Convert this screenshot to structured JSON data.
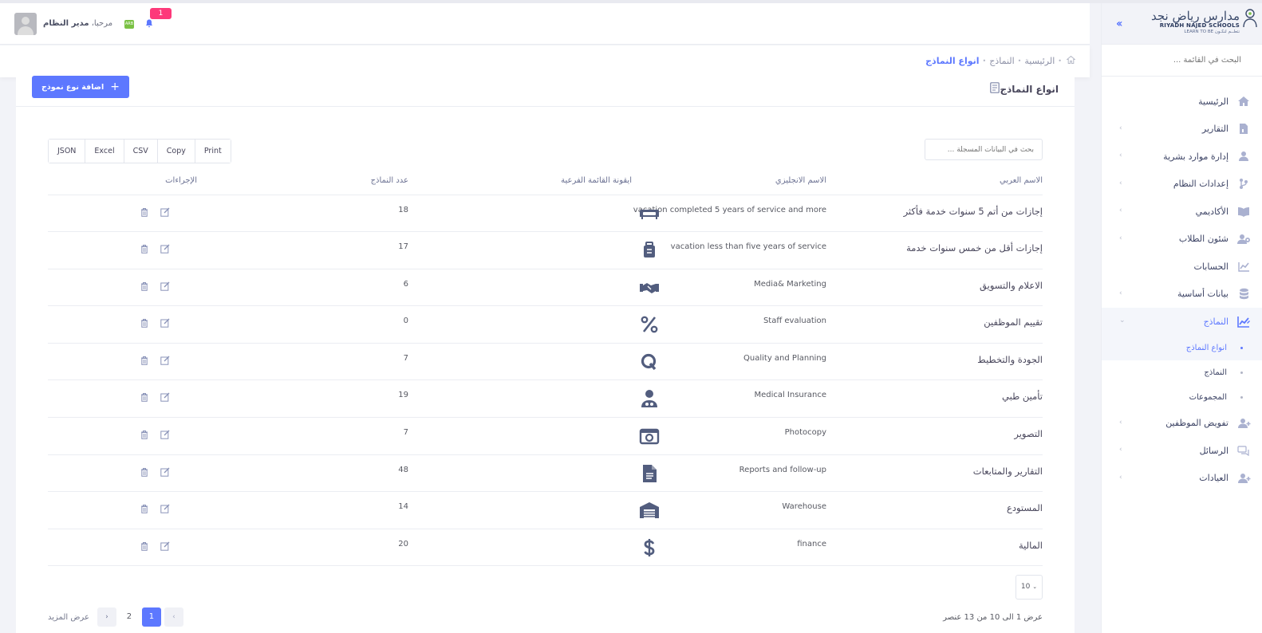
{
  "brand": {
    "name_ar": "مدارس رياض نجد",
    "name_en": "RIYADH NAJED SCHOOLS",
    "tagline": "LEARN TO BE  نتعلــم لنكـون"
  },
  "sidebar": {
    "search_placeholder": "البحث في القائمة ...",
    "items": [
      {
        "label": "الرئيسية",
        "icon": "home-icon",
        "chevron": false
      },
      {
        "label": "التقارير",
        "icon": "report-file-icon",
        "chevron": true
      },
      {
        "label": "إدارة موارد بشرية",
        "icon": "user-icon",
        "chevron": true
      },
      {
        "label": "إعدادات النظام",
        "icon": "git-branch-icon",
        "chevron": true
      },
      {
        "label": "الأكاديمي",
        "icon": "book-icon",
        "chevron": true
      },
      {
        "label": "شئون الطلاب",
        "icon": "users-gear-icon",
        "chevron": true
      },
      {
        "label": "الحسابات",
        "icon": "line-chart-icon",
        "chevron": false
      },
      {
        "label": "بيانات أساسية",
        "icon": "database-icon",
        "chevron": true
      },
      {
        "label": "النماذج",
        "icon": "chart-edit-icon",
        "chevron": true
      }
    ],
    "subitems": [
      {
        "label": "انواع النماذج"
      },
      {
        "label": "النماذج"
      },
      {
        "label": "المجموعات"
      }
    ],
    "items_after": [
      {
        "label": "تفويض الموظفين",
        "icon": "user-add-icon",
        "chevron": true
      },
      {
        "label": "الرسائل",
        "icon": "chat-icon",
        "chevron": true
      },
      {
        "label": "العيادات",
        "icon": "user-add-icon",
        "chevron": true
      }
    ]
  },
  "header": {
    "greeting": "مرحبا،",
    "user": "مدير النظام",
    "notification_count": "1",
    "lang_badge": "ARB"
  },
  "breadcrumb": [
    "الرئيسية",
    "النماذج",
    "انواع النماذج"
  ],
  "portlet": {
    "title": "انواع النماذج",
    "add_button": "اضافة نوع نموذج"
  },
  "export_buttons": [
    "JSON",
    "Excel",
    "CSV",
    "Copy",
    "Print"
  ],
  "table_search_placeholder": "بحث في البيانات المسجلة ...",
  "table": {
    "headers": [
      "الاسم العربي",
      "الاسم الانجليزي",
      "ايقونة القائمة الفرعية",
      "عدد النماذج",
      "الإجراءات"
    ],
    "rows": [
      {
        "ar": "إجازات من أتم 5 سنوات خدمة فأكثر",
        "en": "vacation completed 5 years of service and more",
        "icon": "couch-icon",
        "count": "18"
      },
      {
        "ar": "إجازات أقل من خمس سنوات خدمة",
        "en": "vacation less than five years of service",
        "icon": "suitcase-icon",
        "count": "17"
      },
      {
        "ar": "الاعلام والتسويق",
        "en": "Media& Marketing",
        "icon": "handshake-icon",
        "count": "6"
      },
      {
        "ar": "تقييم الموظفين",
        "en": "Staff evaluation",
        "icon": "percent-icon",
        "count": "0"
      },
      {
        "ar": "الجودة والتخطيط",
        "en": "Quality and Planning",
        "icon": "q-letter-icon",
        "count": "7"
      },
      {
        "ar": "تأمين طبي",
        "en": "Medical Insurance",
        "icon": "user-medical-icon",
        "count": "19"
      },
      {
        "ar": "التصوير",
        "en": "Photocopy",
        "icon": "camera-icon",
        "count": "7"
      },
      {
        "ar": "التقارير والمتابعات",
        "en": "Reports and follow-up",
        "icon": "file-text-icon",
        "count": "48"
      },
      {
        "ar": "المستودع",
        "en": "Warehouse",
        "icon": "warehouse-icon",
        "count": "14"
      },
      {
        "ar": "المالية",
        "en": "finance",
        "icon": "dollar-icon",
        "count": "20"
      }
    ]
  },
  "pagination": {
    "per_page": "10",
    "showing": "عرض 1 الى 10 من 13 عنصر",
    "pages": [
      "1",
      "2"
    ],
    "more_label": "عرض المزيد"
  },
  "colors": {
    "accent": "#5d78ff",
    "badge": "#fd397a",
    "icon": "#525d7e"
  }
}
